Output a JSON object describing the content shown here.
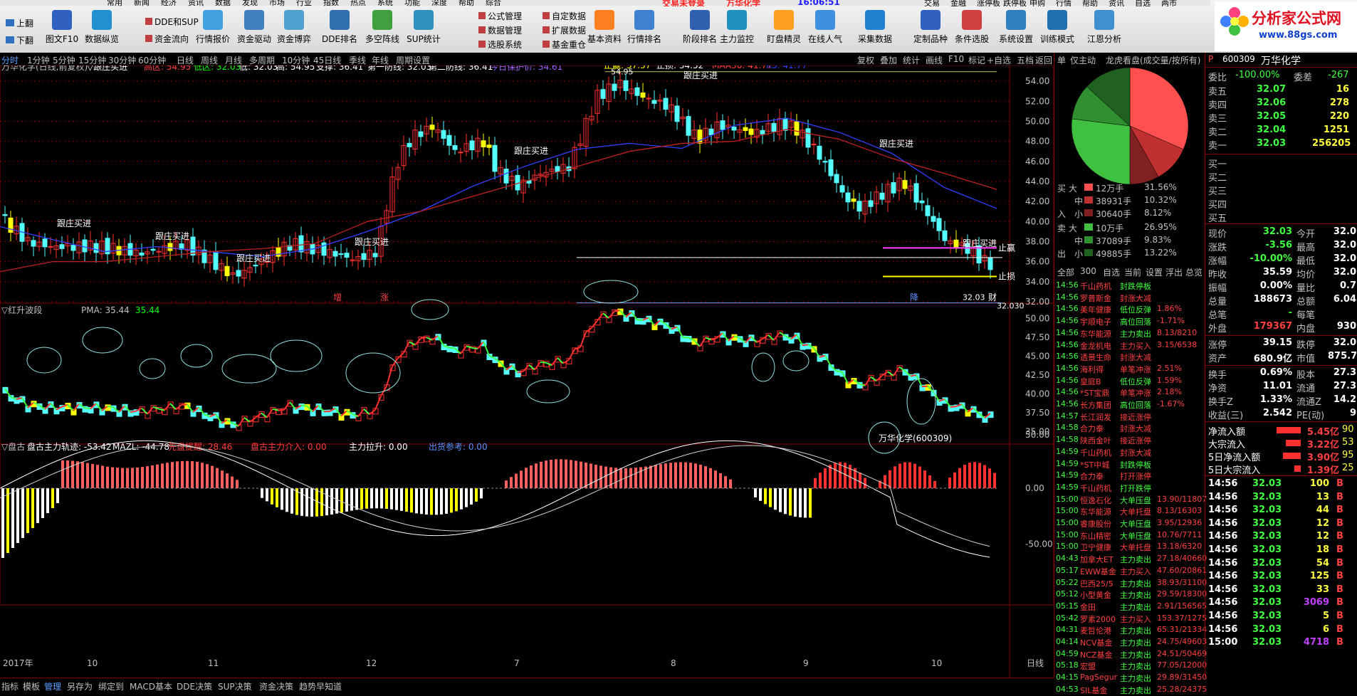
{
  "toolbar": {
    "side_left": [
      "上翻",
      "下翻"
    ],
    "buttons": [
      "图文F10",
      "数据纵览",
      "行情报价",
      "资金驱动",
      "资金博弈",
      "DDE排名",
      "多空阵线",
      "SUP统计",
      "基本资料",
      "行情排名",
      "阶段排名",
      "主力监控",
      "盯盘精灵",
      "在线人气",
      "采集数据",
      "定制品种",
      "条件选股",
      "系统设置",
      "训练模式",
      "江恩分析"
    ],
    "side_mid1": [
      "DDE和SUP",
      "资金流向"
    ],
    "side_mid2": [
      "公式管理",
      "数据管理",
      "选股系统"
    ],
    "side_mid3": [
      "自定数据",
      "扩展数据",
      "基金重仓"
    ],
    "menu": [
      "常用",
      "新闻",
      "经济",
      "资讯",
      "数据",
      "发现",
      "市场",
      "行业",
      "指数",
      "热点",
      "系统",
      "功能",
      "深度",
      "帮助",
      "综合"
    ],
    "ticker_left": "交易未登录",
    "ticker_stock": "万华化学",
    "ticker_time": "16:06:51",
    "ticker_right": [
      "交易",
      "金融",
      "涨停板",
      "跌停板",
      "申购",
      "行情",
      "帮助",
      "资讯",
      "自选",
      "两市"
    ]
  },
  "logo": {
    "title": "分析家公式网",
    "url": "www.88gs.com"
  },
  "periods": [
    "分时",
    "1分钟",
    "5分钟",
    "15分钟",
    "30分钟",
    "60分钟",
    "日线",
    "周线",
    "月线",
    "多周期",
    "10分钟",
    "45日线",
    "季线",
    "年线",
    "周期设置"
  ],
  "chart_tools": [
    "复权",
    "叠加",
    "统计",
    "画线",
    "F10",
    "标记",
    "+自选",
    "五档",
    "返回"
  ],
  "main_panel": {
    "title": "万华化学(日线,前复权)",
    "indicator": "▽跟庄买进",
    "high_zone": "高区: 54.95",
    "low_zone": "低区: 32.03",
    "low": "低: 32.03",
    "high": "高: 54.95",
    "support": "支撑: 36.41",
    "line1": "第一防线: 32.03",
    "line2": "第二防线: 36.41",
    "protect": "今日保护价: 34.61",
    "stop_gain": "止赢: 37.37",
    "stop_loss": "止损: 34.52",
    "maa30": "MAA30: 41.77",
    "ks": "KS: 41.77",
    "yaxis": [
      "54.00",
      "52.00",
      "50.00",
      "48.00",
      "46.00",
      "44.00",
      "42.00",
      "40.00",
      "38.00",
      "36.00",
      "34.00",
      "32.00"
    ],
    "labels": [
      "跟庄买进",
      "跟庄买进",
      "跟庄买进",
      "跟庄买进",
      "跟庄买进",
      "跟庄买进",
      "跟庄买进",
      "跟庄买进"
    ],
    "peak": "54.95",
    "bottom_price": "32.03",
    "bottom_price2": "32.030",
    "right_labels": [
      "止赢",
      "止损"
    ],
    "markers": [
      "增",
      "涨",
      "降",
      "财"
    ]
  },
  "mid_panel": {
    "title": "▽红升波段",
    "pma": "PMA: 35.44",
    "pma2": "35.44",
    "yaxis": [
      "50.00",
      "47.50",
      "45.00",
      "42.50",
      "40.00",
      "37.50",
      "35.00"
    ],
    "stock_label": "万华化学(600309)"
  },
  "low_panel": {
    "title": "▽盘古",
    "track": "盘古主力轨迹: -53.42",
    "mazl": "MAZL: -44.78",
    "warn": "先盘提醒: 28.46",
    "enter": "盘古主力介入: 0.00",
    "pull": "主力拉升: 0.00",
    "ship": "出货参考: 0.00",
    "yaxis": [
      "50.00",
      "0.00",
      "-50.00"
    ]
  },
  "xaxis": [
    "2017年",
    "10",
    "11",
    "12",
    "7",
    "8",
    "9",
    "10"
  ],
  "axis_unit": "日线",
  "bottom_tabs": [
    "指标",
    "模板",
    "管理",
    "另存为",
    "绑定到",
    "MACD基本",
    "DDE决策",
    "SUP决策",
    "资金决策",
    "趋势早知道"
  ],
  "side_panel": {
    "tabs": [
      "仅主动",
      "龙虎看盘(成交量/按所有)"
    ],
    "tab_short": "单",
    "pie": {
      "values": [
        31.56,
        10.32,
        8.12,
        26.95,
        9.83,
        13.22
      ],
      "colors": [
        "#ff5050",
        "#c03030",
        "#802020",
        "#40c040",
        "#309030",
        "#206020"
      ]
    },
    "buy_label": "买",
    "in_label": "入",
    "sell_label": "卖",
    "out_label": "出",
    "flows": [
      {
        "size": "大",
        "amount": "12万手",
        "pct": "31.56%"
      },
      {
        "size": "中",
        "amount": "38931手",
        "pct": "10.32%"
      },
      {
        "size": "小",
        "amount": "30640手",
        "pct": "8.12%"
      },
      {
        "size": "大",
        "amount": "10万手",
        "pct": "26.95%"
      },
      {
        "size": "中",
        "amount": "37089手",
        "pct": "9.83%"
      },
      {
        "size": "小",
        "amount": "49885手",
        "pct": "13.22%"
      }
    ],
    "filters": [
      "全部",
      "300",
      "自选",
      "当前",
      "设置",
      "浮出",
      "总览"
    ],
    "alerts": [
      [
        "14:56",
        "千山药机",
        "封跌停板",
        ""
      ],
      [
        "14:56",
        "罗普斯金",
        "封涨大减",
        ""
      ],
      [
        "14:56",
        "美年健康",
        "低位反弹",
        "1.86%"
      ],
      [
        "14:56",
        "宇顺电子",
        "高位回落",
        "-1.71%"
      ],
      [
        "14:56",
        "东华能源",
        "主力卖出",
        "8.13/8210"
      ],
      [
        "14:56",
        "金龙机电",
        "主力买入",
        "3.15/6538"
      ],
      [
        "14:56",
        "透景生命",
        "封涨大减",
        ""
      ],
      [
        "14:56",
        "海利得",
        "单笔冲涨",
        "2.51%"
      ],
      [
        "14:56",
        "皇庭B",
        "低位反弹",
        "1.59%"
      ],
      [
        "14:56",
        "*ST宝鼎",
        "单笔冲涨",
        "2.18%"
      ],
      [
        "14:56",
        "长方集团",
        "高位回落",
        "-1.67%"
      ],
      [
        "14:57",
        "长江润发",
        "接近涨停",
        ""
      ],
      [
        "14:58",
        "合力泰",
        "封涨大减",
        ""
      ],
      [
        "14:58",
        "陕西金叶",
        "接近涨停",
        ""
      ],
      [
        "14:59",
        "千山药机",
        "封涨大减",
        ""
      ],
      [
        "14:59",
        "*ST中城",
        "封跌停板",
        ""
      ],
      [
        "14:59",
        "合力泰",
        "打开涨停",
        ""
      ],
      [
        "14:59",
        "千山药机",
        "打开跌停",
        ""
      ],
      [
        "15:00",
        "恒逸石化",
        "大单压盘",
        "13.90/11807"
      ],
      [
        "15:00",
        "东华能源",
        "大单托盘",
        "8.13/16303"
      ],
      [
        "15:00",
        "睿康股份",
        "大单压盘",
        "3.95/12936"
      ],
      [
        "15:00",
        "东山精密",
        "大单压盘",
        "10.76/7711"
      ],
      [
        "15:00",
        "卫宁健康",
        "大单托盘",
        "13.18/6320"
      ],
      [
        "04:43",
        "加拿大ET",
        "主力卖出",
        "27.18/40660"
      ],
      [
        "05:17",
        "EWW基金",
        "主力买入",
        "47.60/20861"
      ],
      [
        "05:22",
        "巴西25/5",
        "主力卖出",
        "38.93/31100"
      ],
      [
        "05:12",
        "小型黄金",
        "主力卖出",
        "29.59/18300"
      ],
      [
        "05:15",
        "金田",
        "主力卖出",
        "2.91/156565"
      ],
      [
        "05:42",
        "罗素2000",
        "主力买入",
        "153.37/1275"
      ],
      [
        "04:31",
        "麦哲伦港",
        "主力卖出",
        "65.31/21334"
      ],
      [
        "04:14",
        "NCV基金",
        "主力卖出",
        "24.75/49603"
      ],
      [
        "04:59",
        "NCZ基金",
        "主力卖出",
        "24.51/50469"
      ],
      [
        "05:18",
        "宏盟",
        "主力卖出",
        "77.05/12000"
      ],
      [
        "04:15",
        "PagSegur",
        "主力卖出",
        "29.89/31450"
      ],
      [
        "04:53",
        "SIL基金",
        "主力卖出",
        "25.28/24375"
      ]
    ]
  },
  "quote": {
    "badge": "P",
    "code": "600309",
    "name": "万华化学",
    "wb_label": "委比",
    "wb": "-100.00%",
    "wc_label": "委差",
    "wc": "-267",
    "asks": [
      [
        "卖五",
        "32.07",
        "16"
      ],
      [
        "卖四",
        "32.06",
        "278"
      ],
      [
        "卖三",
        "32.05",
        "220"
      ],
      [
        "卖二",
        "32.04",
        "1251"
      ],
      [
        "卖一",
        "32.03",
        "256205"
      ]
    ],
    "bids": [
      "买一",
      "买二",
      "买三",
      "买四",
      "买五"
    ],
    "stats": [
      [
        "现价",
        "32.03",
        "今开",
        "32.0"
      ],
      [
        "涨跌",
        "-3.56",
        "最高",
        "32.0"
      ],
      [
        "涨幅",
        "-10.00%",
        "最低",
        "32.0"
      ],
      [
        "昨收",
        "35.59",
        "均价",
        "32.0"
      ],
      [
        "振幅",
        "0.00%",
        "量比",
        "0.7"
      ],
      [
        "总量",
        "188673",
        "总额",
        "6.04"
      ],
      [
        "总笔",
        "-",
        "每笔",
        ""
      ],
      [
        "外盘",
        "179367",
        "内盘",
        "930"
      ]
    ],
    "stats2": [
      [
        "涨停",
        "39.15",
        "跌停",
        "32.0"
      ],
      [
        "资产",
        "680.9亿",
        "市值",
        "875.7"
      ]
    ],
    "stats3": [
      [
        "换手",
        "0.69%",
        "股本",
        "27.3"
      ],
      [
        "净资",
        "11.01",
        "流通",
        "27.3"
      ],
      [
        "换手Z",
        "1.33%",
        "流通Z",
        "14.2"
      ],
      [
        "收益(三)",
        "2.542",
        "PE(动)",
        "9"
      ]
    ],
    "flows": [
      [
        "净流入额",
        "5.45亿",
        "90",
        0.9
      ],
      [
        "大宗流入",
        "3.22亿",
        "53",
        0.55
      ],
      [
        "5日净流入额",
        "3.90亿",
        "95",
        0.65
      ],
      [
        "5日大宗流入",
        "1.39亿",
        "25",
        0.25
      ]
    ],
    "ticks": [
      [
        "14:56",
        "32.03",
        "100",
        "B"
      ],
      [
        "14:56",
        "32.03",
        "13",
        "B"
      ],
      [
        "14:56",
        "32.03",
        "44",
        "B"
      ],
      [
        "14:56",
        "32.03",
        "12",
        "B"
      ],
      [
        "14:56",
        "32.03",
        "12",
        "B"
      ],
      [
        "14:56",
        "32.03",
        "18",
        "B"
      ],
      [
        "14:56",
        "32.03",
        "54",
        "B"
      ],
      [
        "14:56",
        "32.03",
        "125",
        "B"
      ],
      [
        "14:56",
        "32.03",
        "33",
        "B"
      ],
      [
        "14:56",
        "32.03",
        "3069",
        "B"
      ],
      [
        "14:56",
        "32.03",
        "5",
        "B"
      ],
      [
        "14:56",
        "32.03",
        "6",
        "B"
      ],
      [
        "15:00",
        "32.03",
        "4718",
        "B"
      ]
    ]
  },
  "colors": {
    "up": "#ff3030",
    "down": "#54ffff",
    "bg": "#000000",
    "grid": "#800000",
    "yellow": "#ffff00",
    "green": "#00c000",
    "blue": "#3040ff"
  },
  "chart_data": [
    {
      "type": "candlestick",
      "title": "万华化学(日线,前复权)",
      "series": [
        {
          "name": "MAA30",
          "values": [
            39.5,
            38.2,
            37.0,
            37.5,
            37.0,
            36.5,
            37.3,
            39.0,
            41.0,
            43.5,
            45.5,
            47.2,
            47.8,
            47.3,
            49.6,
            50.3,
            48.9,
            46.8,
            43.4,
            41.3
          ]
        },
        {
          "name": "KS",
          "values": [
            35.0,
            36.0,
            36.0,
            36.5,
            37.0,
            37.3,
            37.8,
            40.0,
            41.0,
            42.5,
            44.0,
            45.5,
            47.0,
            47.8,
            48.0,
            49.2,
            48.2,
            46.3,
            44.8,
            43.2
          ]
        }
      ],
      "ylim": [
        32.0,
        55.0
      ],
      "peak": 54.95,
      "low": 32.03,
      "support": 36.41,
      "stop_gain": 37.37,
      "stop_loss": 34.52
    }
  ]
}
